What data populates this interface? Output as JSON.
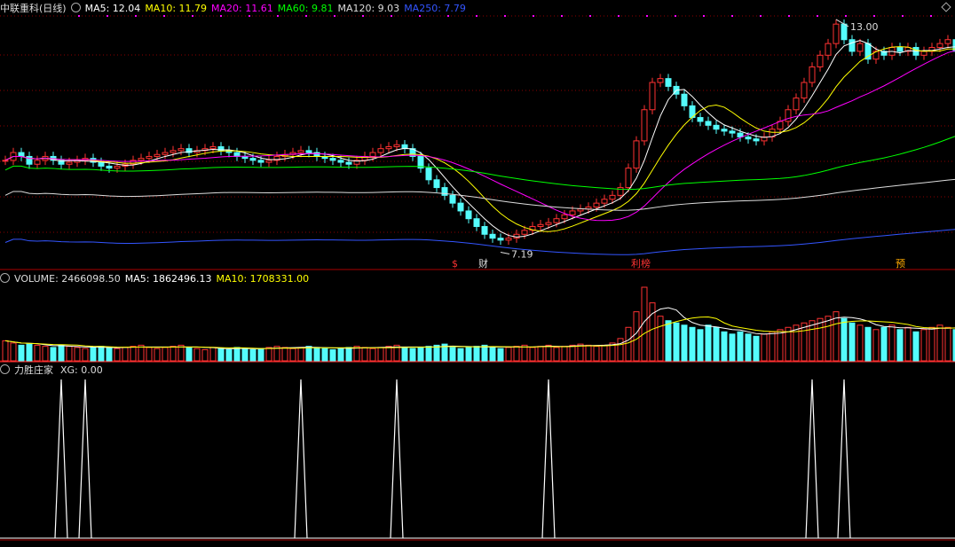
{
  "header": {
    "stock_title": "中联重科(日线)",
    "ma": [
      {
        "label": "MA5: 12.04",
        "color": "#ffffff"
      },
      {
        "label": "MA10: 11.79",
        "color": "#ffff00"
      },
      {
        "label": "MA20: 11.61",
        "color": "#ff00ff"
      },
      {
        "label": "MA60: 9.81",
        "color": "#00ff00"
      },
      {
        "label": "MA120: 9.03",
        "color": "#dddddd"
      },
      {
        "label": "MA250: 7.79",
        "color": "#3355ff"
      }
    ]
  },
  "volume_header": {
    "title": "VOLUME: 2466098.50",
    "ma5": "MA5: 1862496.13",
    "ma10": "MA10: 1708331.00"
  },
  "indicator_header": {
    "title": "力胜庄家",
    "xg": "XG: 0.00"
  },
  "tags": [
    {
      "text": "$",
      "color": "#ff3333"
    },
    {
      "text": "财",
      "color": "#dddddd"
    },
    {
      "text": "利榜",
      "color": "#ff3333"
    },
    {
      "text": "预",
      "color": "#ffaa00"
    }
  ],
  "colors": {
    "up": "#ff3232",
    "down": "#54fcfc",
    "grid": "#8b0000",
    "ma5": "#ffffff",
    "ma10": "#ffff00",
    "ma20": "#ff00ff",
    "ma60": "#00ff00",
    "ma120": "#dddddd",
    "ma250": "#3355ff",
    "signal": "#ffffff"
  },
  "chart_data": {
    "type": "candlestick",
    "annotations": [
      {
        "label": "13.00",
        "kind": "max",
        "value": 13.0
      },
      {
        "label": "7.19",
        "kind": "min",
        "value": 7.19
      }
    ],
    "price_range": [
      6.9,
      13.3
    ],
    "closes": [
      9.5,
      9.7,
      9.6,
      9.4,
      9.5,
      9.6,
      9.5,
      9.4,
      9.45,
      9.5,
      9.55,
      9.45,
      9.35,
      9.3,
      9.35,
      9.4,
      9.5,
      9.55,
      9.6,
      9.65,
      9.7,
      9.75,
      9.8,
      9.7,
      9.75,
      9.8,
      9.85,
      9.75,
      9.7,
      9.6,
      9.55,
      9.5,
      9.45,
      9.5,
      9.6,
      9.65,
      9.7,
      9.75,
      9.7,
      9.6,
      9.55,
      9.5,
      9.45,
      9.4,
      9.5,
      9.6,
      9.7,
      9.8,
      9.85,
      9.9,
      9.8,
      9.6,
      9.3,
      9.0,
      8.8,
      8.6,
      8.4,
      8.2,
      8.0,
      7.8,
      7.6,
      7.5,
      7.45,
      7.5,
      7.6,
      7.7,
      7.8,
      7.85,
      7.9,
      8.0,
      8.1,
      8.2,
      8.25,
      8.3,
      8.4,
      8.5,
      8.6,
      8.8,
      9.3,
      10.0,
      10.8,
      11.5,
      11.6,
      11.4,
      11.2,
      10.9,
      10.6,
      10.5,
      10.4,
      10.3,
      10.25,
      10.2,
      10.1,
      10.05,
      10.0,
      10.1,
      10.3,
      10.5,
      10.8,
      11.1,
      11.5,
      11.9,
      12.2,
      12.5,
      13.0,
      12.6,
      12.3,
      12.5,
      12.1,
      12.3,
      12.2,
      12.4,
      12.3,
      12.4,
      12.2,
      12.3,
      12.4,
      12.5,
      12.6,
      12.3
    ],
    "volumes": [
      0.9,
      0.8,
      0.7,
      0.75,
      0.7,
      0.65,
      0.6,
      0.7,
      0.65,
      0.6,
      0.55,
      0.6,
      0.65,
      0.6,
      0.55,
      0.6,
      0.65,
      0.7,
      0.6,
      0.55,
      0.6,
      0.65,
      0.7,
      0.6,
      0.55,
      0.5,
      0.6,
      0.55,
      0.5,
      0.6,
      0.55,
      0.5,
      0.55,
      0.6,
      0.65,
      0.6,
      0.55,
      0.6,
      0.65,
      0.6,
      0.55,
      0.5,
      0.55,
      0.6,
      0.65,
      0.6,
      0.55,
      0.6,
      0.65,
      0.7,
      0.6,
      0.55,
      0.6,
      0.65,
      0.7,
      0.75,
      0.6,
      0.55,
      0.6,
      0.65,
      0.7,
      0.6,
      0.55,
      0.6,
      0.65,
      0.7,
      0.6,
      0.65,
      0.7,
      0.6,
      0.65,
      0.7,
      0.75,
      0.7,
      0.65,
      0.7,
      0.8,
      1.0,
      1.5,
      2.2,
      3.3,
      2.6,
      2.0,
      1.8,
      1.7,
      1.6,
      1.5,
      1.4,
      1.6,
      1.5,
      1.3,
      1.2,
      1.3,
      1.2,
      1.1,
      1.2,
      1.3,
      1.4,
      1.5,
      1.6,
      1.7,
      1.8,
      1.9,
      2.0,
      2.2,
      1.9,
      1.7,
      1.6,
      1.5,
      1.4,
      1.5,
      1.6,
      1.4,
      1.5,
      1.3,
      1.4,
      1.5,
      1.6,
      1.5,
      1.4
    ],
    "signals": [
      7,
      10,
      37,
      49,
      68,
      101,
      105
    ]
  }
}
